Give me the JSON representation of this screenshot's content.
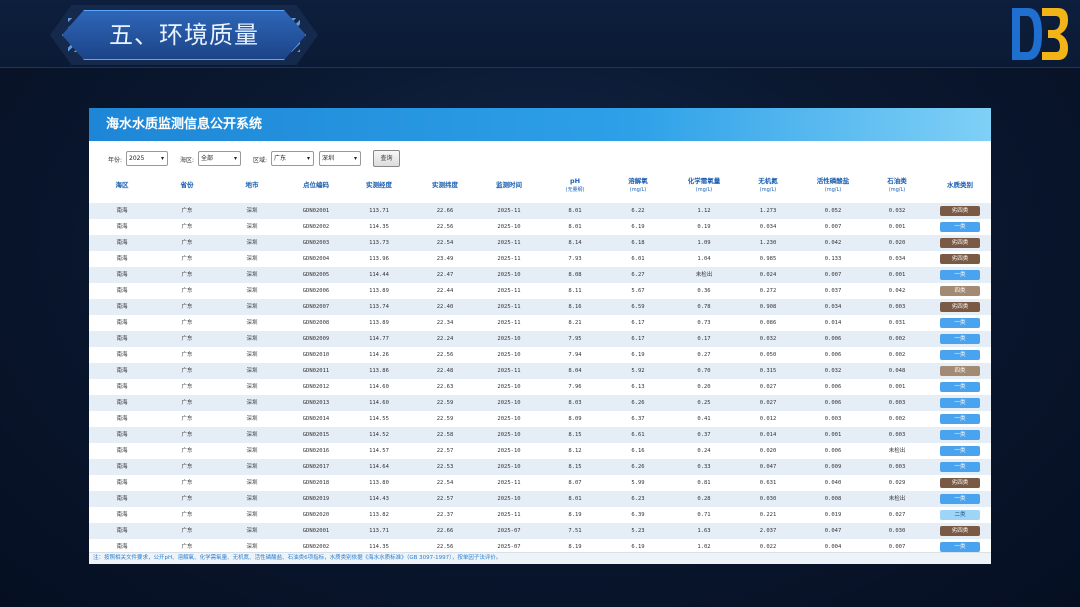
{
  "slide": {
    "title": "五、环境质量"
  },
  "app": {
    "title": "海水水质监测信息公开系统"
  },
  "filters": {
    "year_label": "年份:",
    "year_value": "2025",
    "sea_label": "海区:",
    "sea_value": "全部",
    "region_label": "区域:",
    "province_value": "广东",
    "city_value": "深圳",
    "query_button": "查询"
  },
  "columns": [
    {
      "label": "海区",
      "unit": ""
    },
    {
      "label": "省份",
      "unit": ""
    },
    {
      "label": "地市",
      "unit": ""
    },
    {
      "label": "点位编码",
      "unit": ""
    },
    {
      "label": "实测经度",
      "unit": ""
    },
    {
      "label": "实测纬度",
      "unit": ""
    },
    {
      "label": "监测时间",
      "unit": ""
    },
    {
      "label": "pH",
      "unit": "(无量纲)"
    },
    {
      "label": "溶解氧",
      "unit": "(mg/L)"
    },
    {
      "label": "化学需氧量",
      "unit": "(mg/L)"
    },
    {
      "label": "无机氮",
      "unit": "(mg/L)"
    },
    {
      "label": "活性磷酸盐",
      "unit": "(mg/L)"
    },
    {
      "label": "石油类",
      "unit": "(mg/L)"
    },
    {
      "label": "水质类别",
      "unit": ""
    }
  ],
  "quality_colors": {
    "劣四类": "#7a5a44",
    "四类": "#a38a72",
    "一类": "#4aa3ef",
    "二类": "#9ed4f5"
  },
  "rows": [
    [
      "南海",
      "广东",
      "深圳",
      "GDN02001",
      "113.71",
      "22.66",
      "2025-11",
      "8.01",
      "6.22",
      "1.12",
      "1.273",
      "0.052",
      "0.032",
      "劣四类"
    ],
    [
      "南海",
      "广东",
      "深圳",
      "GDN02002",
      "114.35",
      "22.56",
      "2025-10",
      "8.01",
      "6.19",
      "0.19",
      "0.034",
      "0.007",
      "0.001",
      "一类"
    ],
    [
      "南海",
      "广东",
      "深圳",
      "GDN02003",
      "113.73",
      "22.54",
      "2025-11",
      "8.14",
      "6.18",
      "1.09",
      "1.230",
      "0.042",
      "0.020",
      "劣四类"
    ],
    [
      "南海",
      "广东",
      "深圳",
      "GDN02004",
      "113.96",
      "23.49",
      "2025-11",
      "7.93",
      "6.01",
      "1.04",
      "0.985",
      "0.133",
      "0.034",
      "劣四类"
    ],
    [
      "南海",
      "广东",
      "深圳",
      "GDN02005",
      "114.44",
      "22.47",
      "2025-10",
      "8.08",
      "6.27",
      "未检出",
      "0.024",
      "0.007",
      "0.001",
      "一类"
    ],
    [
      "南海",
      "广东",
      "深圳",
      "GDN02006",
      "113.89",
      "22.44",
      "2025-11",
      "8.11",
      "5.67",
      "0.36",
      "0.272",
      "0.037",
      "0.042",
      "四类"
    ],
    [
      "南海",
      "广东",
      "深圳",
      "GDN02007",
      "113.74",
      "22.40",
      "2025-11",
      "8.16",
      "6.59",
      "0.78",
      "0.908",
      "0.034",
      "0.003",
      "劣四类"
    ],
    [
      "南海",
      "广东",
      "深圳",
      "GDN02008",
      "113.89",
      "22.34",
      "2025-11",
      "8.21",
      "6.17",
      "0.73",
      "0.086",
      "0.014",
      "0.031",
      "一类"
    ],
    [
      "南海",
      "广东",
      "深圳",
      "GDN02009",
      "114.77",
      "22.24",
      "2025-10",
      "7.95",
      "6.17",
      "0.17",
      "0.032",
      "0.006",
      "0.002",
      "一类"
    ],
    [
      "南海",
      "广东",
      "深圳",
      "GDN02010",
      "114.26",
      "22.56",
      "2025-10",
      "7.94",
      "6.19",
      "0.27",
      "0.050",
      "0.006",
      "0.002",
      "一类"
    ],
    [
      "南海",
      "广东",
      "深圳",
      "GDN02011",
      "113.86",
      "22.48",
      "2025-11",
      "8.04",
      "5.92",
      "0.70",
      "0.315",
      "0.032",
      "0.048",
      "四类"
    ],
    [
      "南海",
      "广东",
      "深圳",
      "GDN02012",
      "114.60",
      "22.63",
      "2025-10",
      "7.96",
      "6.13",
      "0.20",
      "0.027",
      "0.006",
      "0.001",
      "一类"
    ],
    [
      "南海",
      "广东",
      "深圳",
      "GDN02013",
      "114.60",
      "22.59",
      "2025-10",
      "8.03",
      "6.26",
      "0.25",
      "0.027",
      "0.006",
      "0.003",
      "一类"
    ],
    [
      "南海",
      "广东",
      "深圳",
      "GDN02014",
      "114.55",
      "22.59",
      "2025-10",
      "8.09",
      "6.37",
      "0.41",
      "0.012",
      "0.003",
      "0.002",
      "一类"
    ],
    [
      "南海",
      "广东",
      "深圳",
      "GDN02015",
      "114.52",
      "22.58",
      "2025-10",
      "8.15",
      "6.61",
      "0.37",
      "0.014",
      "0.001",
      "0.003",
      "一类"
    ],
    [
      "南海",
      "广东",
      "深圳",
      "GDN02016",
      "114.57",
      "22.57",
      "2025-10",
      "8.12",
      "6.16",
      "0.24",
      "0.020",
      "0.006",
      "未检出",
      "一类"
    ],
    [
      "南海",
      "广东",
      "深圳",
      "GDN02017",
      "114.64",
      "22.53",
      "2025-10",
      "8.15",
      "6.26",
      "0.33",
      "0.047",
      "0.009",
      "0.003",
      "一类"
    ],
    [
      "南海",
      "广东",
      "深圳",
      "GDN02018",
      "113.80",
      "22.54",
      "2025-11",
      "8.07",
      "5.99",
      "0.81",
      "0.631",
      "0.040",
      "0.029",
      "劣四类"
    ],
    [
      "南海",
      "广东",
      "深圳",
      "GDN02019",
      "114.43",
      "22.57",
      "2025-10",
      "8.01",
      "6.23",
      "0.28",
      "0.030",
      "0.008",
      "未检出",
      "一类"
    ],
    [
      "南海",
      "广东",
      "深圳",
      "GDN02020",
      "113.82",
      "22.37",
      "2025-11",
      "8.19",
      "6.39",
      "0.71",
      "0.221",
      "0.019",
      "0.027",
      "二类"
    ],
    [
      "南海",
      "广东",
      "深圳",
      "GDN02001",
      "113.71",
      "22.66",
      "2025-07",
      "7.51",
      "5.23",
      "1.63",
      "2.037",
      "0.047",
      "0.030",
      "劣四类"
    ],
    [
      "南海",
      "广东",
      "深圳",
      "GDN02002",
      "114.35",
      "22.56",
      "2025-07",
      "8.19",
      "6.19",
      "1.02",
      "0.022",
      "0.004",
      "0.007",
      "一类"
    ]
  ],
  "footer_note": "注：按照相关文件要求，公开pH、溶解氧、化学需氧量、无机氮、活性磷酸盐、石油类6项指标，水质类别依据《海水水质标准》（GB 3097-1997），按单因子法评价。"
}
